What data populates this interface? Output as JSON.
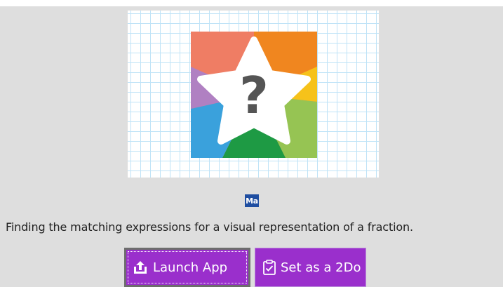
{
  "app": {
    "subject_badge": "Ma",
    "description": "Finding the matching expressions for a visual representation of a fraction.",
    "thumbnail_icon": "question-star-icon"
  },
  "actions": {
    "launch_label": "Launch App",
    "launch_icon": "upload-icon",
    "set_2do_label": "Set as a 2Do",
    "set_2do_icon": "clipboard-check-icon"
  },
  "colors": {
    "panel_bg": "#dedede",
    "button_purple": "#9a2fcc",
    "badge_blue": "#1f4ea1",
    "grid_blue": "#bfe3f7"
  }
}
